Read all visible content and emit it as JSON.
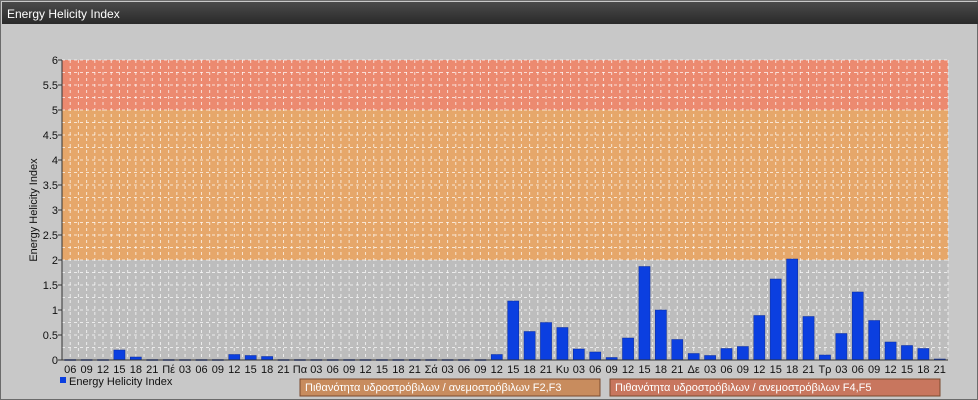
{
  "window": {
    "title": "Energy Helicity Index"
  },
  "chart_data": {
    "type": "bar",
    "ylabel": "Energy Helicity Index",
    "ylim": [
      0,
      6
    ],
    "yticks": [
      "0",
      "0.5",
      "1",
      "1.5",
      "2",
      "2.5",
      "3",
      "3.5",
      "4",
      "4.5",
      "5",
      "5.5",
      "6"
    ],
    "grid": true,
    "legend_position": "bottom-left",
    "zones": [
      {
        "from": 0,
        "to": 2,
        "color": "#bdbdbd"
      },
      {
        "from": 2,
        "to": 5,
        "color": "#e6a76a"
      },
      {
        "from": 5,
        "to": 6,
        "color": "#ec8a70"
      }
    ],
    "categories": [
      "06",
      "09",
      "12",
      "15",
      "18",
      "21",
      "Πέ",
      "03",
      "06",
      "09",
      "12",
      "15",
      "18",
      "21",
      "Πα",
      "03",
      "06",
      "09",
      "12",
      "15",
      "18",
      "21",
      "Σά",
      "03",
      "06",
      "09",
      "12",
      "15",
      "18",
      "21",
      "Κυ",
      "03",
      "06",
      "09",
      "12",
      "15",
      "18",
      "21",
      "Δε",
      "03",
      "06",
      "09",
      "12",
      "15",
      "18",
      "21",
      "Τρ",
      "03",
      "06",
      "09",
      "12",
      "15",
      "18",
      "21"
    ],
    "series": [
      {
        "name": "Energy Helicity Index",
        "color": "#0b3fe0",
        "values": [
          0.01,
          0.01,
          0.01,
          0.2,
          0.06,
          0.01,
          0.01,
          0.01,
          0.01,
          0.01,
          0.11,
          0.09,
          0.07,
          0.01,
          0.01,
          0.01,
          0.01,
          0.01,
          0.01,
          0.01,
          0.01,
          0.01,
          0.01,
          0.01,
          0.01,
          0.01,
          0.11,
          1.18,
          0.57,
          0.75,
          0.65,
          0.22,
          0.16,
          0.05,
          0.44,
          1.87,
          1.0,
          0.41,
          0.13,
          0.09,
          0.23,
          0.27,
          0.89,
          1.62,
          2.02,
          0.87,
          0.1,
          0.53,
          1.36,
          0.79,
          0.36,
          0.29,
          0.23,
          0.02
        ]
      }
    ],
    "legend": {
      "label": "Energy Helicity Index"
    },
    "zone_labels": [
      {
        "text": "Πιθανότητα υδροστρόβιλων / ανεμοστρόβιλων F2,F3",
        "color": "#c88c5e"
      },
      {
        "text": "Πιθανότητα υδροστρόβιλων / ανεμοστρόβιλων F4,F5",
        "color": "#c8765e"
      }
    ]
  }
}
